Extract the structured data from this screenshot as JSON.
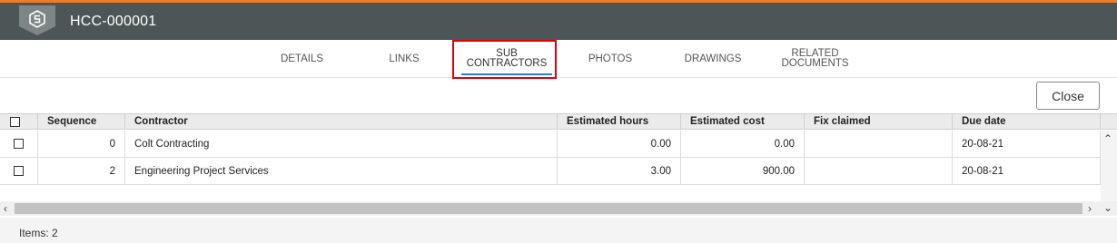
{
  "header": {
    "title": "HCC-000001",
    "logo": "s-logo-icon"
  },
  "tabs": [
    {
      "label1": "DETAILS",
      "label2": ""
    },
    {
      "label1": "LINKS",
      "label2": ""
    },
    {
      "label1": "SUB",
      "label2": "CONTRACTORS"
    },
    {
      "label1": "PHOTOS",
      "label2": ""
    },
    {
      "label1": "DRAWINGS",
      "label2": ""
    },
    {
      "label1": "RELATED",
      "label2": "DOCUMENTS"
    }
  ],
  "active_tab": "SUB CONTRACTORS",
  "close_label": "Close",
  "table": {
    "columns": [
      "Sequence",
      "Contractor",
      "Estimated hours",
      "Estimated cost",
      "Fix claimed",
      "Due date"
    ],
    "rows": [
      {
        "sequence": "0",
        "contractor": "Colt Contracting",
        "hours": "0.00",
        "cost": "0.00",
        "fix_claimed": "",
        "due": "20-08-21"
      },
      {
        "sequence": "2",
        "contractor": "Engineering Project Services",
        "hours": "3.00",
        "cost": "900.00",
        "fix_claimed": "",
        "due": "20-08-21"
      }
    ]
  },
  "footer": {
    "items": "Items: 2"
  },
  "colors": {
    "accent": "#f07a2a",
    "header_bg": "#4d5656",
    "highlight": "#e0000e",
    "tab_underline": "#2d7fcf"
  }
}
